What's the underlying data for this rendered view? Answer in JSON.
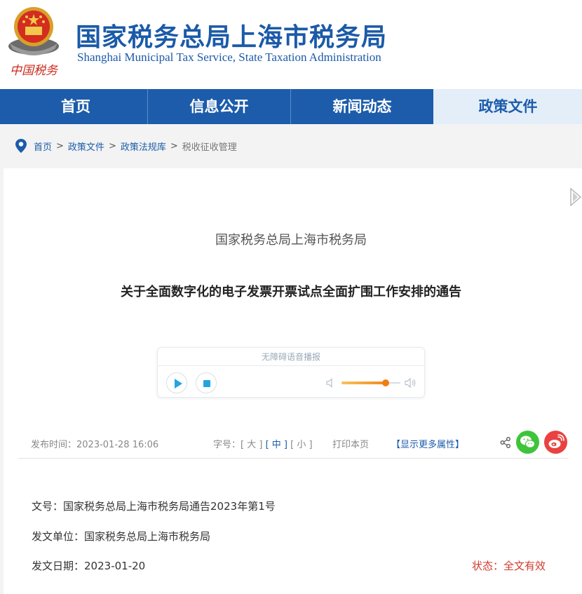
{
  "header": {
    "title": "国家税务总局上海市税务局",
    "subtitle": "Shanghai Municipal Tax Service, State Taxation Administration",
    "logo_caption": "中国税务"
  },
  "nav": {
    "items": [
      {
        "label": "首页",
        "active": false
      },
      {
        "label": "信息公开",
        "active": false
      },
      {
        "label": "新闻动态",
        "active": false
      },
      {
        "label": "政策文件",
        "active": true
      }
    ]
  },
  "breadcrumb": {
    "items": [
      "首页",
      "政策文件",
      "政策法规库",
      "税收征收管理"
    ],
    "separator": ">"
  },
  "article": {
    "issuer": "国家税务总局上海市税务局",
    "title": "关于全面数字化的电子发票开票试点全面扩围工作安排的通告"
  },
  "player": {
    "title": "无障碍语音播报",
    "volume": 0.75
  },
  "meta": {
    "pubtime_label": "发布时间：",
    "pubtime": "2023-01-28 16:06",
    "fontsize_label": "字号：",
    "fontsize_options": [
      "[ 大 ]",
      "[ 中 ]",
      "[ 小 ]"
    ],
    "fontsize_current": "中",
    "print_label": "打印本页",
    "more_label": "【显示更多属性】"
  },
  "document": {
    "number_label": "文号：",
    "number": "国家税务总局上海市税务局通告2023年第1号",
    "unit_label": "发文单位：",
    "unit": "国家税务总局上海市税务局",
    "date_label": "发文日期：",
    "date": "2023-01-20",
    "status_label": "状态：",
    "status": "全文有效"
  },
  "colors": {
    "brand_blue": "#1c5cab",
    "nav_active_bg": "#e3eef9",
    "status_red": "#d03a2c",
    "wechat_green": "#3ec43b",
    "weibo_red": "#e94240"
  }
}
